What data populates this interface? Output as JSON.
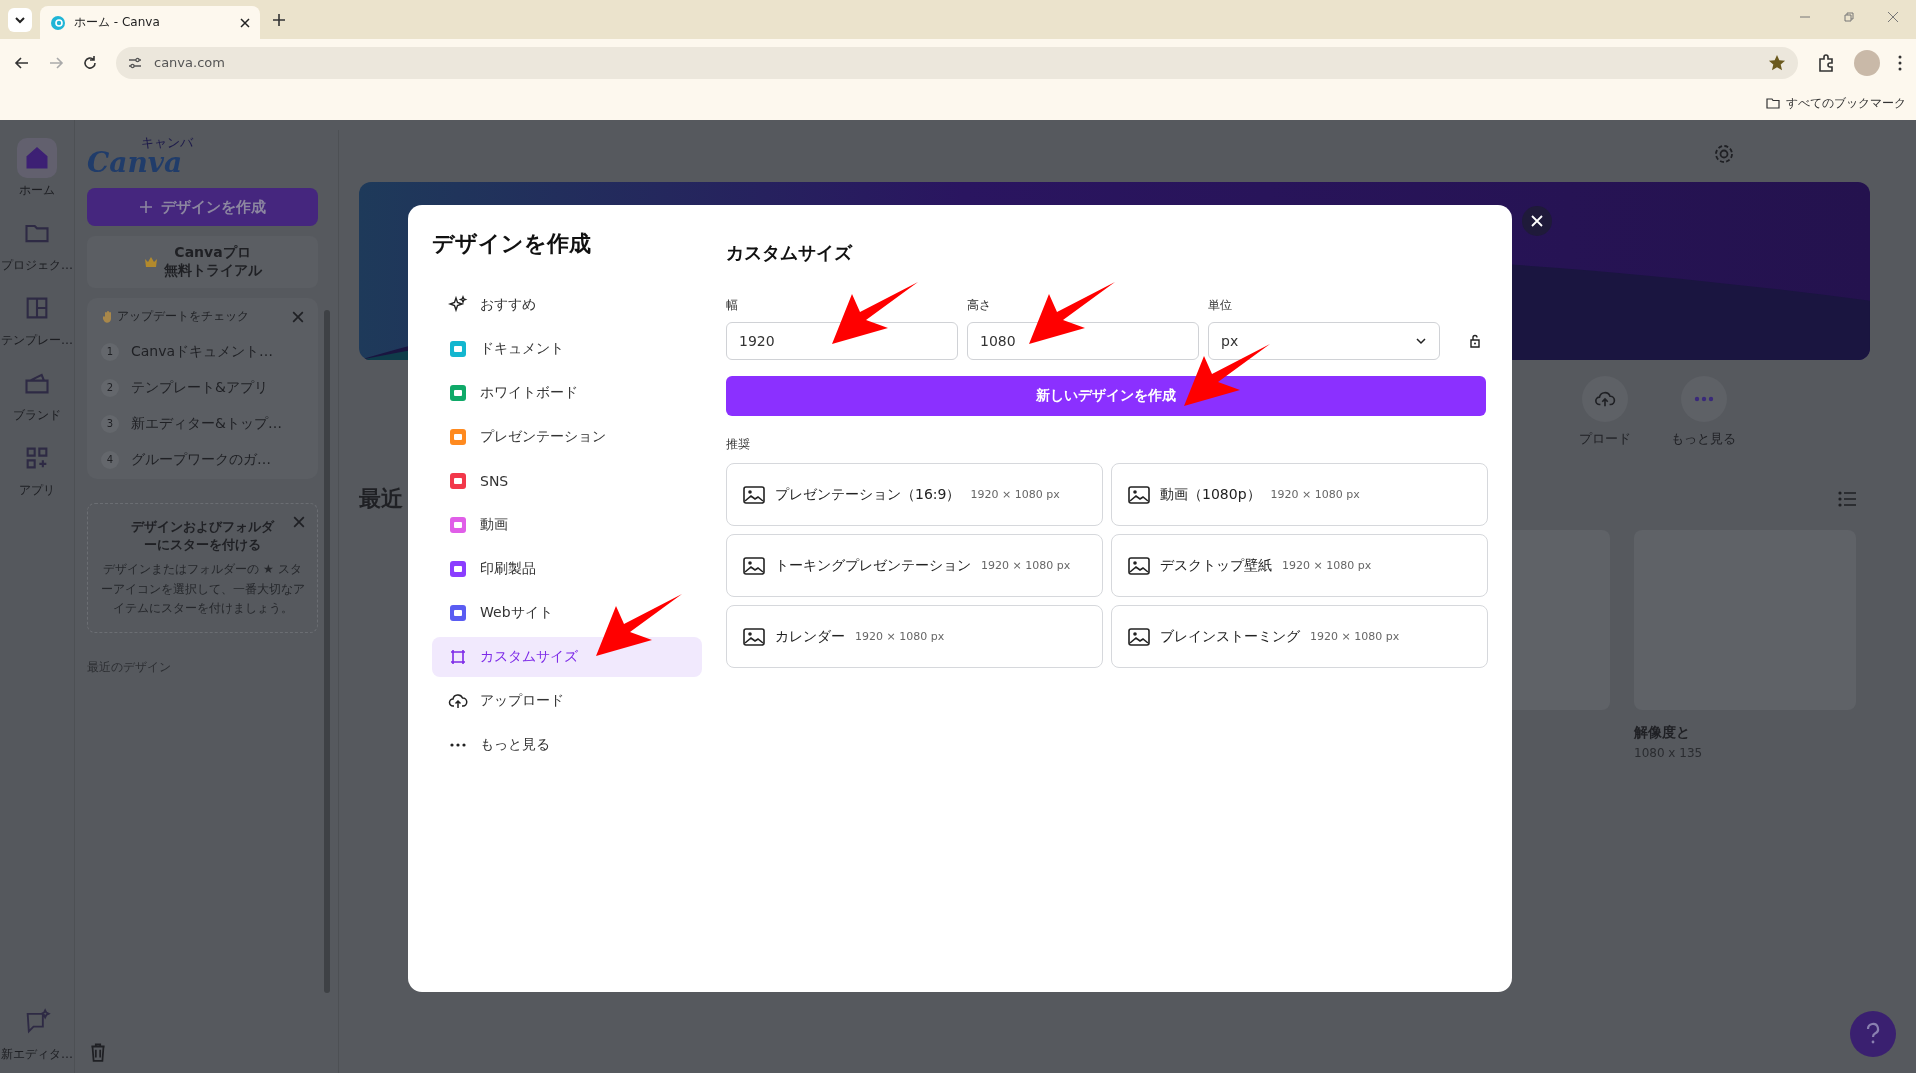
{
  "browser": {
    "tab_title": "ホーム - Canva",
    "url": "canva.com",
    "bookmarks_label": "すべてのブックマーク"
  },
  "rail": [
    {
      "label": "ホーム",
      "kind": "home",
      "selected": true
    },
    {
      "label": "プロジェク…",
      "kind": "folder",
      "selected": false
    },
    {
      "label": "テンプレー…",
      "kind": "template",
      "selected": false
    },
    {
      "label": "ブランド",
      "kind": "brand",
      "selected": false
    },
    {
      "label": "アプリ",
      "kind": "apps",
      "selected": false
    }
  ],
  "rail_bottom": {
    "label": "新エディタ…"
  },
  "sidebar": {
    "logo": "Canva",
    "logo_sub": "キャンバ",
    "create_button": "デザインを作成",
    "trial": [
      "Canvaプロ",
      "無料トライアル"
    ],
    "updates": {
      "title": "アップデートをチェック",
      "items": [
        {
          "number": "1",
          "label": "Canvaドキュメント…"
        },
        {
          "number": "2",
          "label": "テンプレート&アプリ"
        },
        {
          "number": "3",
          "label": "新エディター&トップ…"
        },
        {
          "number": "4",
          "label": "グループワークのガ…"
        }
      ]
    },
    "star_tip": {
      "title": "デザインおよびフォルダーにスターを付ける",
      "body": "デザインまたはフォルダーの ★ スターアイコンを選択して、一番大切なアイテムにスターを付けましょう。"
    },
    "recent_label": "最近のデザイン"
  },
  "main": {
    "recent_heading": "最近",
    "shortcuts": [
      {
        "label": "プロード",
        "kind": "upload"
      },
      {
        "label": "もっと見る",
        "kind": "more"
      }
    ],
    "design_title": "解像度と",
    "design_size": "1080 x 135"
  },
  "modal": {
    "title": "デザインを作成",
    "categories": [
      {
        "label": "おすすめ",
        "kind": "sparkle",
        "selected": false
      },
      {
        "label": "ドキュメント",
        "kind": "doc",
        "selected": false
      },
      {
        "label": "ホワイトボード",
        "kind": "whiteboard",
        "selected": false
      },
      {
        "label": "プレゼンテーション",
        "kind": "presentation",
        "selected": false
      },
      {
        "label": "SNS",
        "kind": "sns",
        "selected": false
      },
      {
        "label": "動画",
        "kind": "video",
        "selected": false
      },
      {
        "label": "印刷製品",
        "kind": "print",
        "selected": false
      },
      {
        "label": "Webサイト",
        "kind": "web",
        "selected": false
      },
      {
        "label": "カスタムサイズ",
        "kind": "custom",
        "selected": true
      },
      {
        "label": "アップロード",
        "kind": "upload",
        "selected": false
      },
      {
        "label": "もっと見る",
        "kind": "more",
        "selected": false
      }
    ],
    "panel_title": "カスタムサイズ",
    "fields": [
      {
        "label": "幅",
        "value": "1920"
      },
      {
        "label": "高さ",
        "value": "1080"
      }
    ],
    "unit": {
      "label": "単位",
      "value": "px"
    },
    "create_button": "新しいデザインを作成",
    "recommended_label": "推奨",
    "presets": [
      {
        "name": "プレゼンテーション（16:9）",
        "size": "1920 × 1080 px"
      },
      {
        "name": "動画（1080p）",
        "size": "1920 × 1080 px"
      },
      {
        "name": "トーキングプレゼンテーション",
        "size": "1920 × 1080 px"
      },
      {
        "name": "デスクトップ壁紙",
        "size": "1920 × 1080 px"
      },
      {
        "name": "カレンダー",
        "size": "1920 × 1080 px"
      },
      {
        "name": "ブレインストーミング",
        "size": "1920 × 1080 px"
      }
    ]
  }
}
